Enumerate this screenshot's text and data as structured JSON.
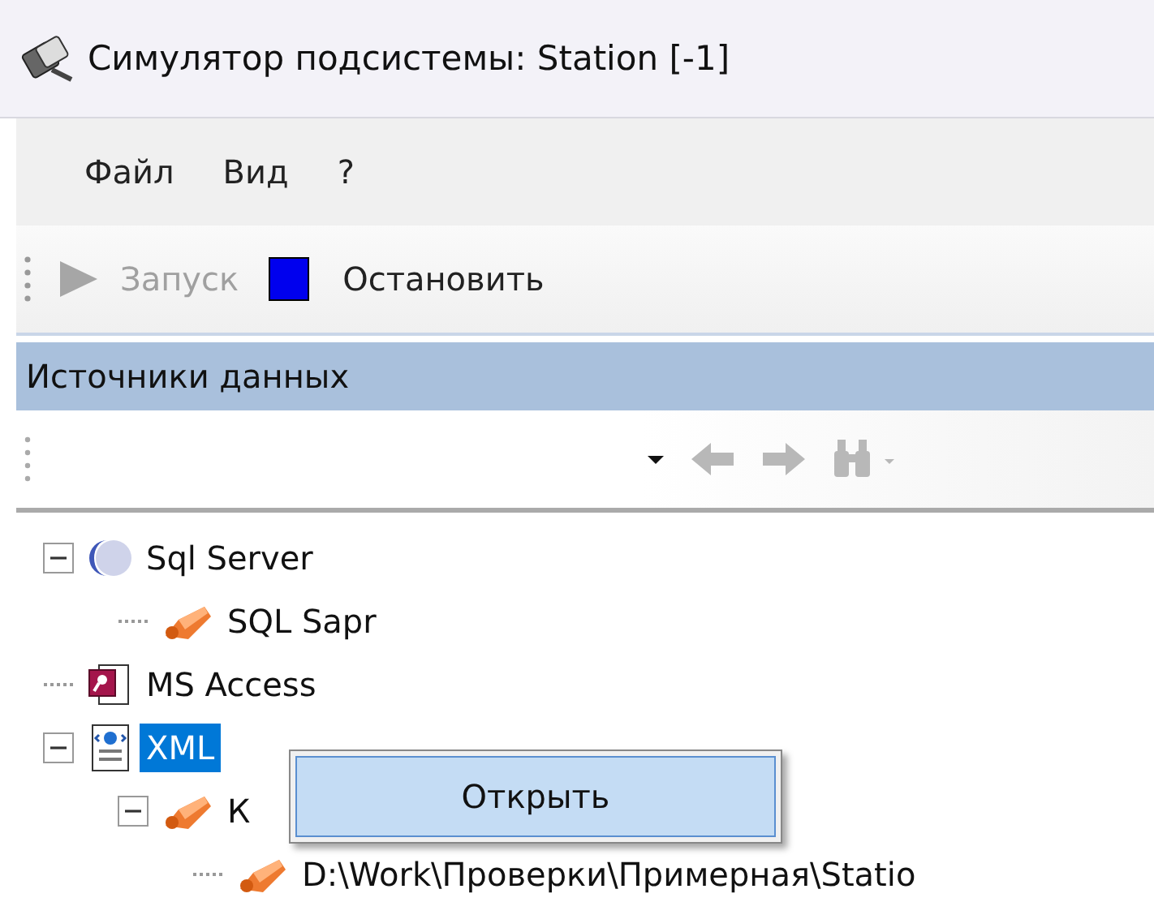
{
  "window": {
    "title": "Симулятор подсистемы: Station [-1]"
  },
  "menu": [
    {
      "label": "Файл"
    },
    {
      "label": "Вид"
    },
    {
      "label": "?"
    }
  ],
  "toolbar": [
    {
      "kind": "run",
      "label": "Запуск",
      "disabled": true
    },
    {
      "kind": "stop",
      "label": "Остановить",
      "disabled": false
    }
  ],
  "panel": {
    "title": "Источники данных"
  },
  "nav_toolbar": [
    {
      "kind": "dropdown",
      "disabled": false
    },
    {
      "kind": "back",
      "disabled": true
    },
    {
      "kind": "forward",
      "disabled": true
    },
    {
      "kind": "find",
      "disabled": true
    }
  ],
  "tree": [
    {
      "label": "Sql Server",
      "kind": "server",
      "selected": false,
      "expanded": true,
      "children": [
        {
          "label": "SQL Sapr",
          "kind": "connection",
          "selected": false
        }
      ]
    },
    {
      "label": "MS Access",
      "kind": "access",
      "selected": false
    },
    {
      "label": "XML",
      "kind": "xml",
      "selected": true,
      "expanded": true,
      "children": [
        {
          "label": "К",
          "kind": "connection",
          "selected": false,
          "expanded": true,
          "children": [
            {
              "label": "D:\\Work\\Проверки\\Примерная\\Statio",
              "kind": "connection",
              "selected": false
            }
          ]
        }
      ]
    }
  ],
  "context_menu": [
    {
      "label": "Открыть",
      "selected": true
    }
  ]
}
